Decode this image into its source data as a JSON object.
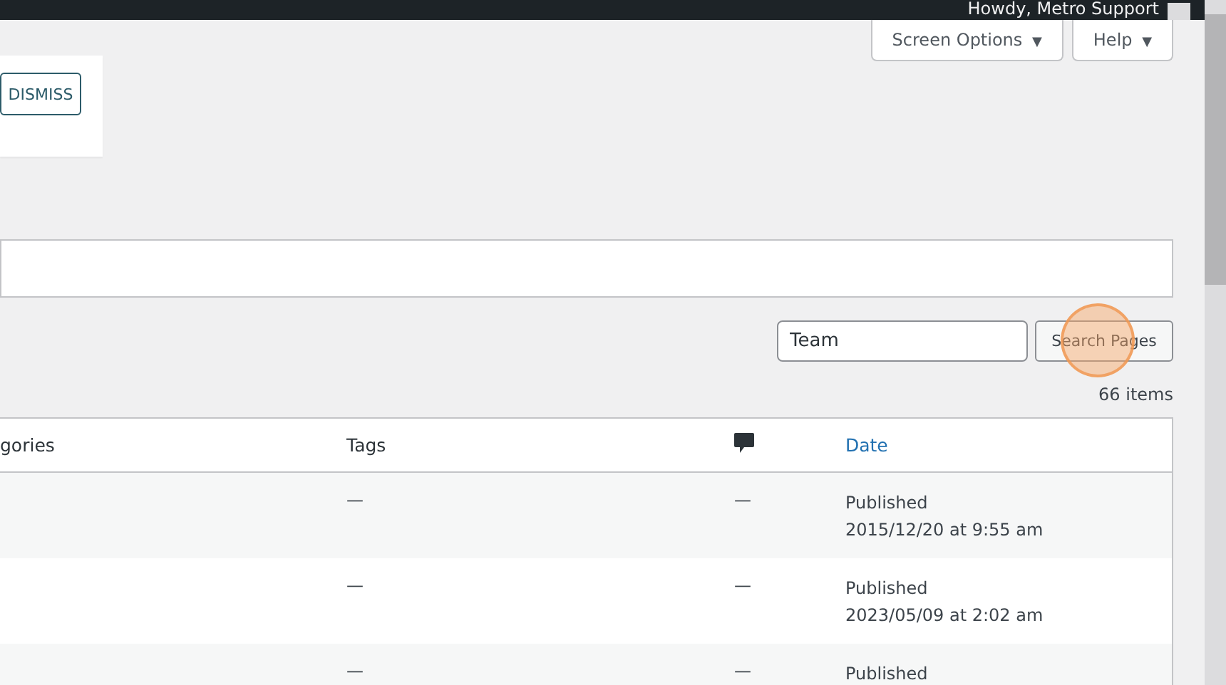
{
  "admin_bar": {
    "greeting": "Howdy, Metro Support"
  },
  "header_buttons": [
    {
      "label": "Screen Options",
      "caret": "▼"
    },
    {
      "label": "Help",
      "caret": "▼"
    }
  ],
  "notice": {
    "button": "DISMISS"
  },
  "search": {
    "value": "Team",
    "button": "Search Pages"
  },
  "item_count": "66 items",
  "table": {
    "columns": [
      {
        "label": "gories",
        "kind": "text"
      },
      {
        "label": "Tags",
        "kind": "text"
      },
      {
        "kind": "comments"
      },
      {
        "label": "Date",
        "kind": "link"
      }
    ],
    "rows": [
      {
        "tags": "—",
        "comments": "—",
        "date": [
          "Published",
          "2015/12/20 at 9:55 am"
        ]
      },
      {
        "tags": "—",
        "comments": "—",
        "date": [
          "Published",
          "2023/05/09 at 2:02 am"
        ]
      },
      {
        "tags": "—",
        "comments": "—",
        "date": [
          "Published"
        ]
      }
    ]
  }
}
